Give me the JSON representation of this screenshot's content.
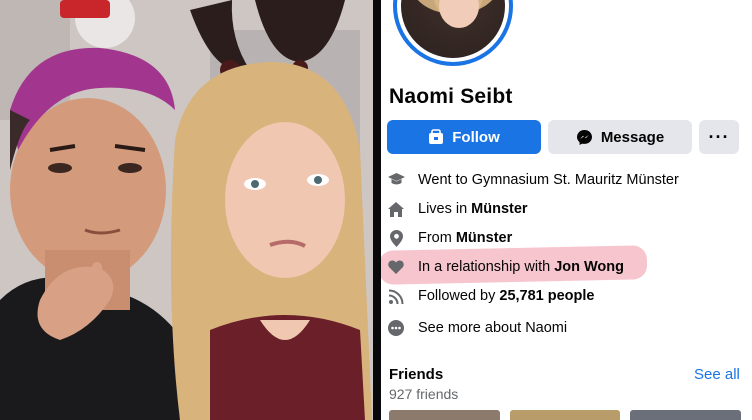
{
  "profile": {
    "name": "Naomi Seibt",
    "buttons": {
      "follow_label": "Follow",
      "message_label": "Message",
      "more_label": "···"
    },
    "details": [
      {
        "icon": "graduation-cap-icon",
        "text": "Went to Gymnasium St. Mauritz Münster",
        "bold": ""
      },
      {
        "icon": "home-icon",
        "text": "Lives in",
        "bold": "Münster"
      },
      {
        "icon": "location-pin-icon",
        "text": "From",
        "bold": "Münster"
      },
      {
        "icon": "heart-icon",
        "text": "In a relationship with",
        "bold": "Jon Wong"
      },
      {
        "icon": "rss-icon",
        "text": "Followed by",
        "bold": "25,781 people"
      },
      {
        "icon": "more-dots-icon",
        "text": "See more about Naomi",
        "bold": ""
      }
    ],
    "friends": {
      "title": "Friends",
      "count": "927 friends",
      "see_all": "See all"
    }
  },
  "colors": {
    "accent": "#1b74e4",
    "secondary_button": "#e4e6eb",
    "highlight": "#f096a5",
    "muted_text": "#65676b",
    "icon": "#65676b"
  }
}
